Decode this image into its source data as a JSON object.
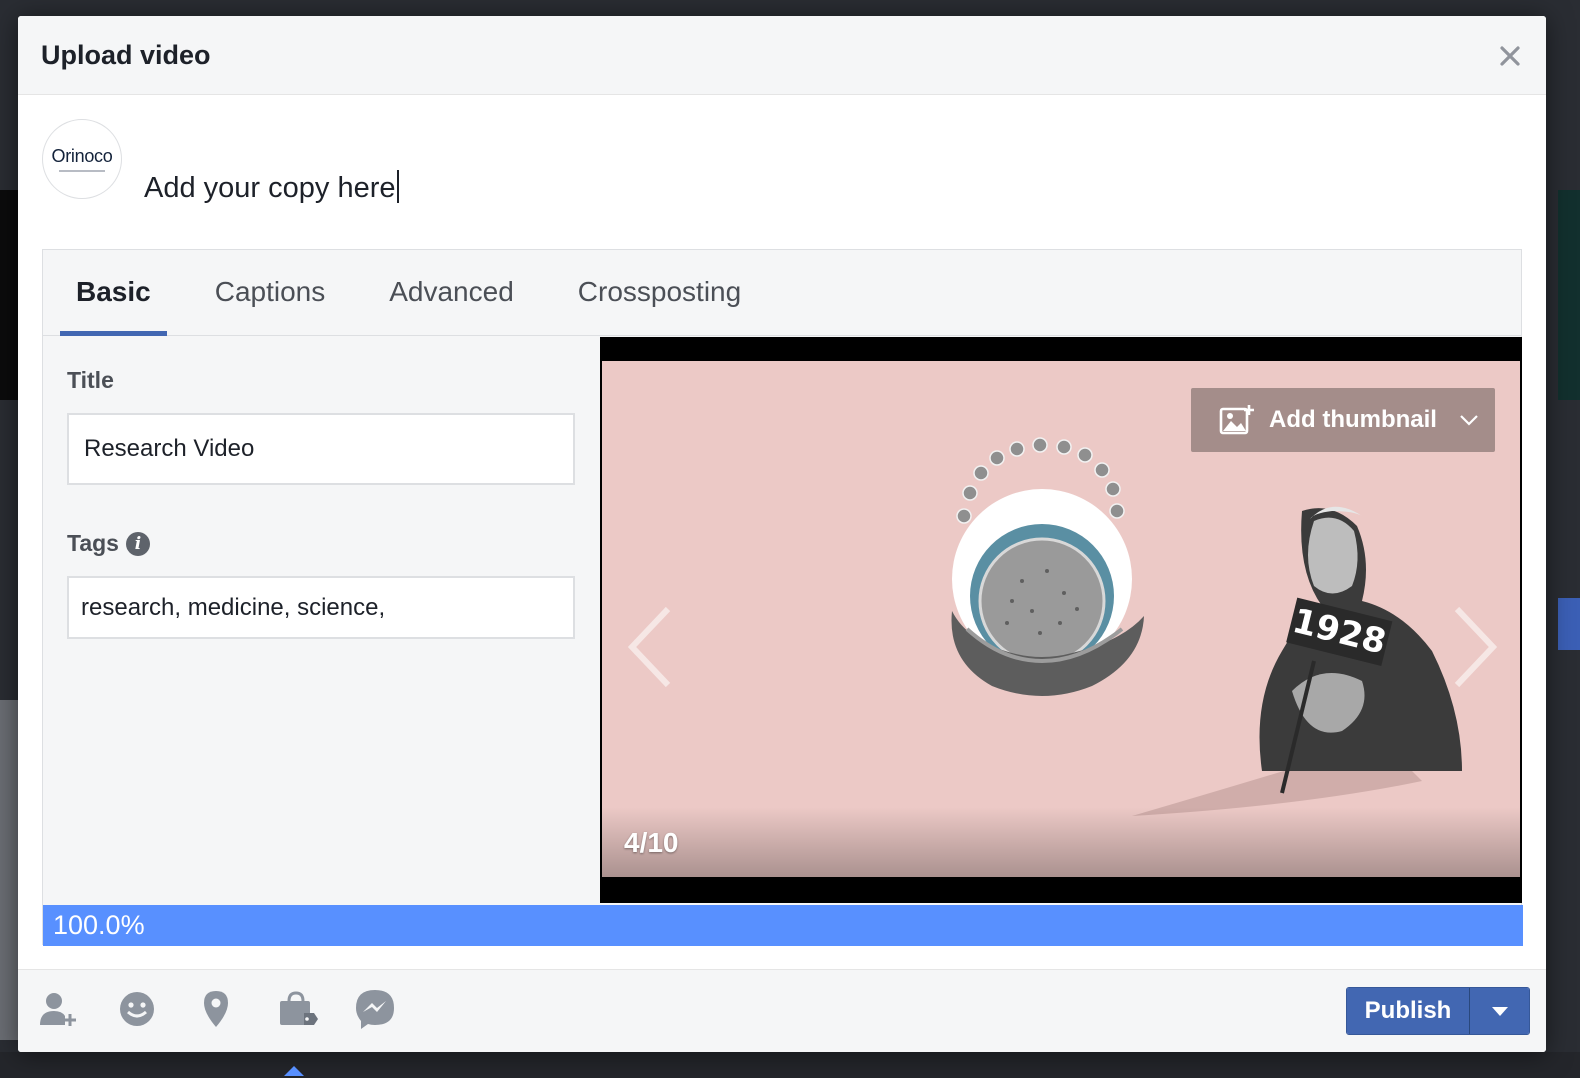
{
  "dialog": {
    "title": "Upload video",
    "close_icon": "close-icon"
  },
  "composer": {
    "avatar_name": "Orinoco",
    "text": "Add your copy here"
  },
  "tabs": [
    {
      "label": "Basic",
      "active": true
    },
    {
      "label": "Captions",
      "active": false
    },
    {
      "label": "Advanced",
      "active": false
    },
    {
      "label": "Crossposting",
      "active": false
    }
  ],
  "form": {
    "title_label": "Title",
    "title_value": "Research Video",
    "tags_label": "Tags",
    "tags_value": "research, medicine, science,"
  },
  "preview": {
    "add_thumbnail_label": "Add thumbnail",
    "frame_counter": "4/10",
    "image_year": "1928"
  },
  "upload": {
    "progress_text": "100.0%",
    "progress_fraction": 1.0,
    "progress_color": "#5890ff"
  },
  "footer": {
    "icons": [
      "tag-people-icon",
      "feeling-icon",
      "location-icon",
      "shop-bag-icon",
      "messenger-icon"
    ],
    "publish_label": "Publish"
  },
  "colors": {
    "brand": "#4267b2",
    "preview_background": "#ecc9c6"
  }
}
